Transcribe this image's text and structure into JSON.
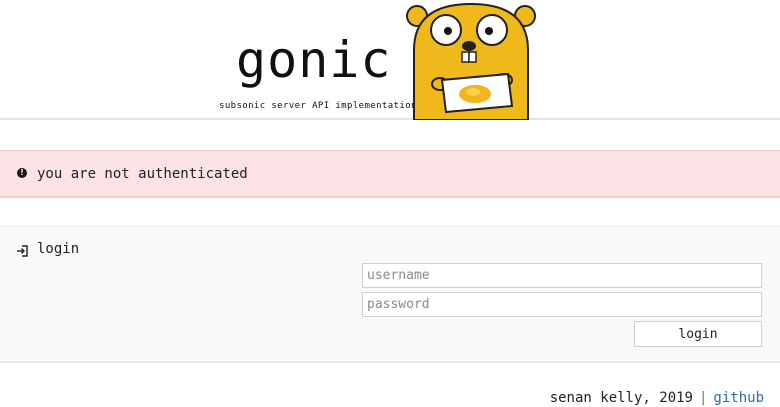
{
  "header": {
    "brand": "gonic",
    "tagline": "subsonic server API implementation",
    "mascot_icon": "gopher-mascot-icon"
  },
  "alert": {
    "icon": "exclamation-circle-icon",
    "message": "you are not authenticated",
    "background": "#fce4e6"
  },
  "login": {
    "icon": "sign-in-icon",
    "title": "login",
    "username_placeholder": "username",
    "password_placeholder": "password",
    "submit_label": "login"
  },
  "footer": {
    "credit": "senan kelly, 2019",
    "separator": "|",
    "link_label": "github",
    "link_color": "#2b6cb0"
  }
}
